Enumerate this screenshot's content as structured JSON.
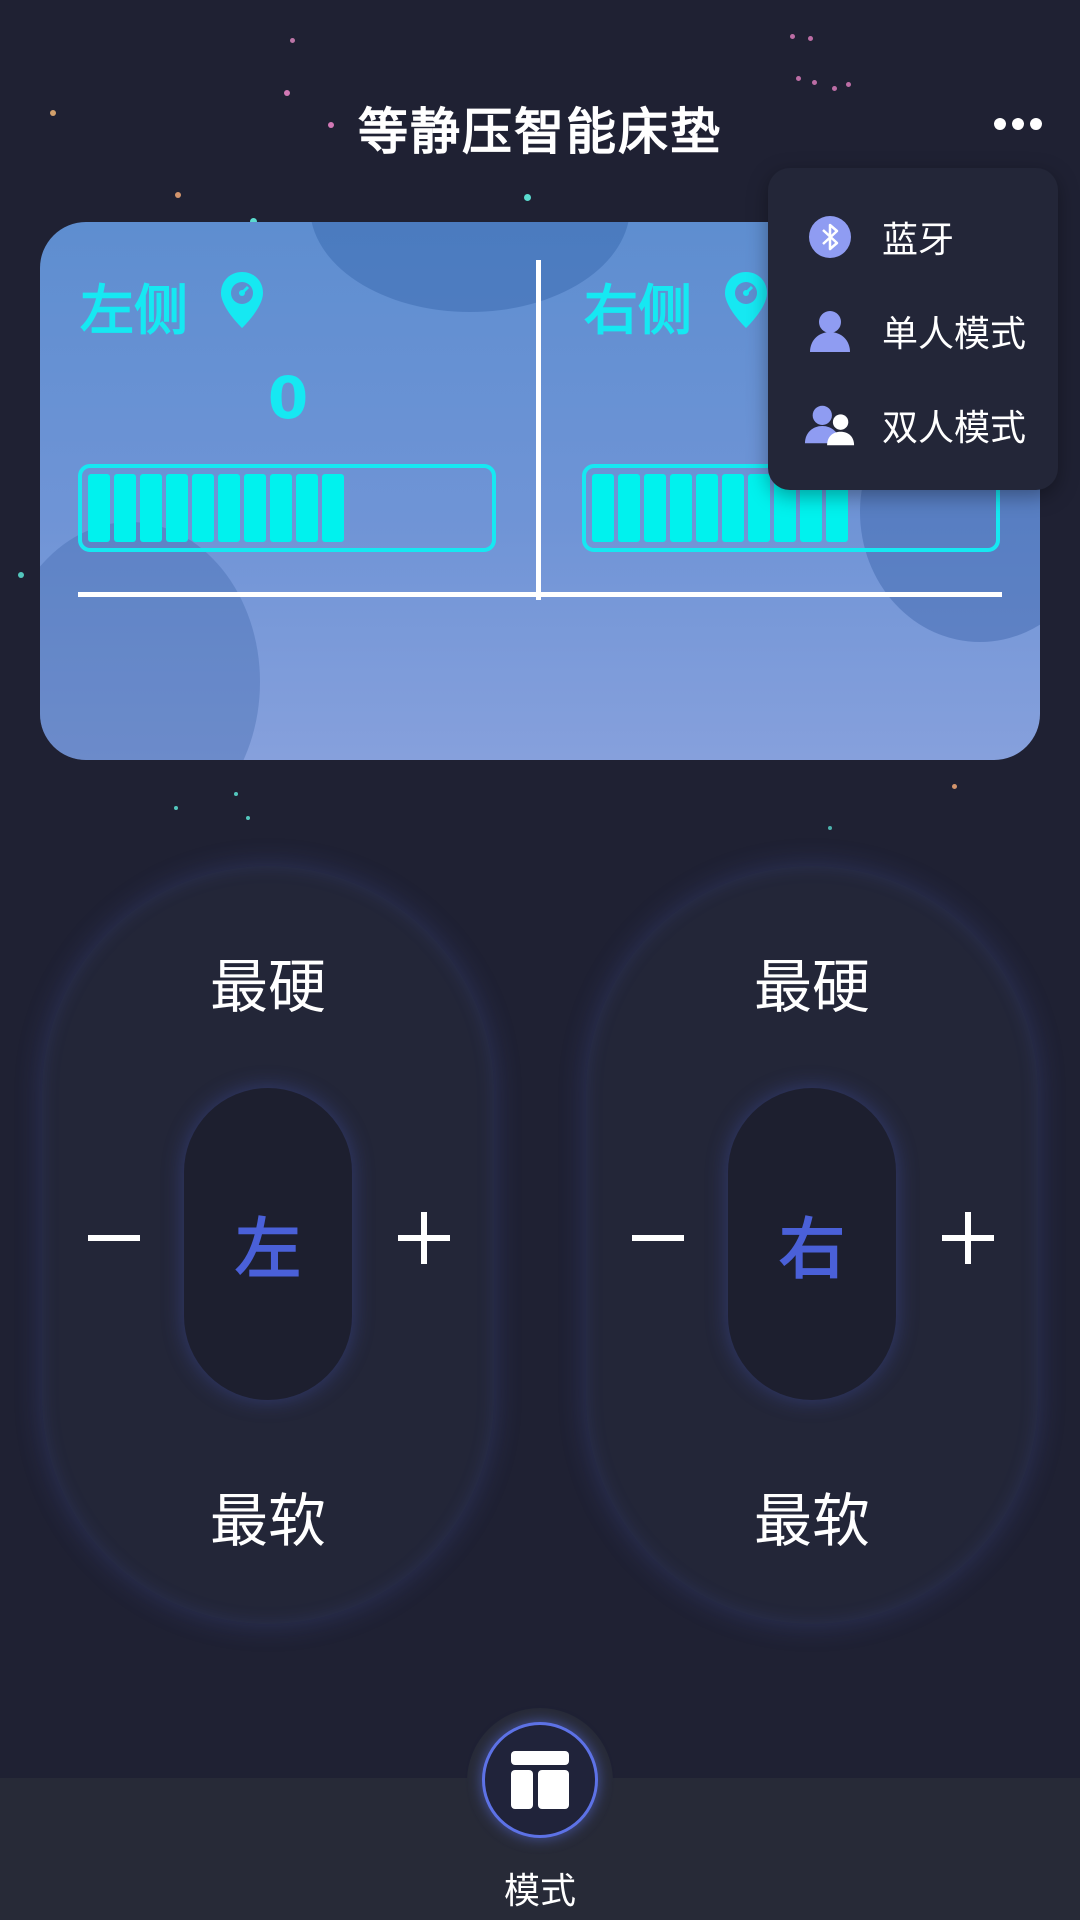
{
  "header": {
    "title": "等静压智能床垫",
    "more_icon": "more-dots-icon"
  },
  "status_card": {
    "left": {
      "label": "左侧",
      "icon": "location-pin-icon",
      "value": "0",
      "level": 10
    },
    "right": {
      "label": "右侧",
      "icon": "location-pin-icon",
      "level": 10
    },
    "accent_color": "#16e8f2"
  },
  "menu": {
    "items": [
      {
        "label": "蓝牙",
        "icon": "bluetooth-icon"
      },
      {
        "label": "单人模式",
        "icon": "single-user-icon"
      },
      {
        "label": "双人模式",
        "icon": "two-users-icon"
      }
    ]
  },
  "controls": {
    "left": {
      "top_label": "最硬",
      "bottom_label": "最软",
      "center_label": "左"
    },
    "right": {
      "top_label": "最硬",
      "bottom_label": "最软",
      "center_label": "右"
    },
    "knob_color": "#4a60d8"
  },
  "bottom_nav": {
    "mode_label": "模式",
    "mode_icon": "layout-icon",
    "ring_color": "#5d72e6"
  }
}
